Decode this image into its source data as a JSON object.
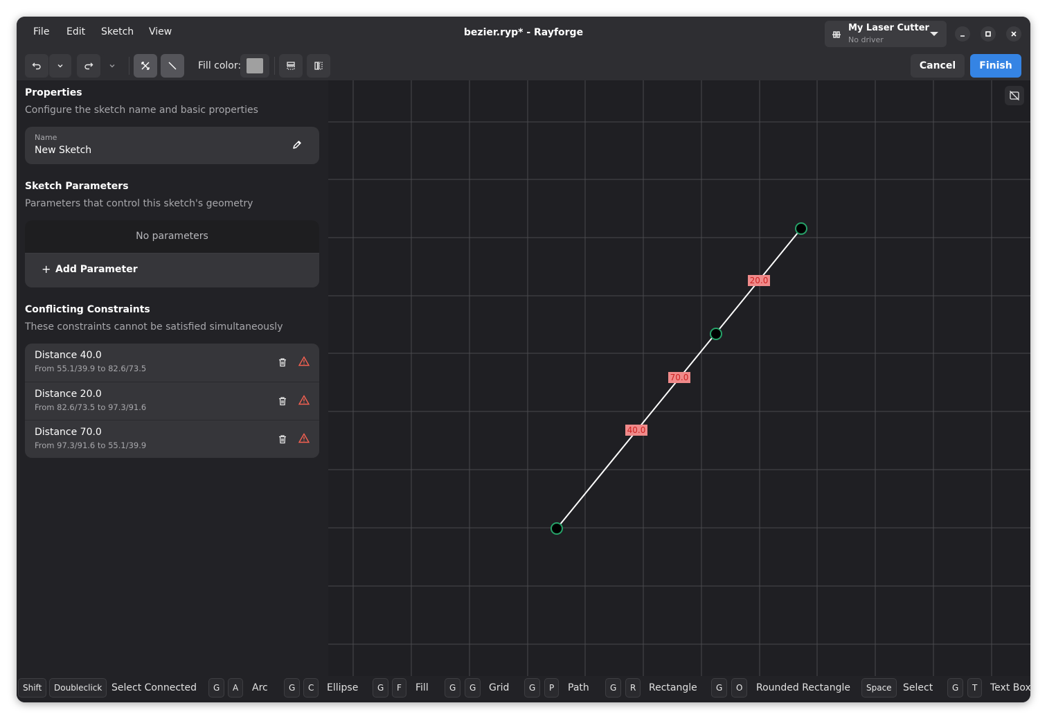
{
  "menu": [
    "File",
    "Edit",
    "Sketch",
    "View"
  ],
  "window_title": "bezier.ryp* - Rayforge",
  "machine": {
    "name": "My Laser Cutter",
    "driver": "No driver"
  },
  "toolbar": {
    "fill_label": "Fill color:",
    "fill_color": "#a0a0a0",
    "cancel_label": "Cancel",
    "finish_label": "Finish",
    "accent_color": "#3584e4"
  },
  "properties": {
    "title": "Properties",
    "description": "Configure the sketch name and basic properties",
    "name_label": "Name",
    "name_value": "New Sketch"
  },
  "parameters": {
    "title": "Sketch Parameters",
    "description": "Parameters that control this sketch's geometry",
    "empty_text": "No parameters",
    "add_label": "Add Parameter"
  },
  "conflicts": {
    "title": "Conflicting Constraints",
    "description": "These constraints cannot be satisfied simultaneously",
    "warning_color": "#f66151",
    "items": [
      {
        "title": "Distance 40.0",
        "subtitle": "From 55.1/39.9 to 82.6/73.5"
      },
      {
        "title": "Distance 20.0",
        "subtitle": "From 82.6/73.5 to 97.3/91.6"
      },
      {
        "title": "Distance 70.0",
        "subtitle": "From 97.3/91.6 to 55.1/39.9"
      }
    ]
  },
  "canvas": {
    "dimension_labels": [
      "20.0",
      "70.0",
      "40.0"
    ],
    "dimension_bg": "#f08a8a",
    "dimension_text_color": "#cc2222",
    "point_ring_color": "#26a269"
  },
  "shortcuts": [
    {
      "keys": [
        "Shift",
        "Doubleclick"
      ],
      "label": "Select Connected"
    },
    {
      "keys": [
        "G",
        "A"
      ],
      "label": "Arc"
    },
    {
      "keys": [
        "G",
        "C"
      ],
      "label": "Ellipse"
    },
    {
      "keys": [
        "G",
        "F"
      ],
      "label": "Fill"
    },
    {
      "keys": [
        "G",
        "G"
      ],
      "label": "Grid"
    },
    {
      "keys": [
        "G",
        "P"
      ],
      "label": "Path"
    },
    {
      "keys": [
        "G",
        "R"
      ],
      "label": "Rectangle"
    },
    {
      "keys": [
        "G",
        "O"
      ],
      "label": "Rounded Rectangle"
    },
    {
      "keys": [
        "Space"
      ],
      "label": "Select"
    },
    {
      "keys": [
        "G",
        "T"
      ],
      "label": "Text Box"
    }
  ]
}
